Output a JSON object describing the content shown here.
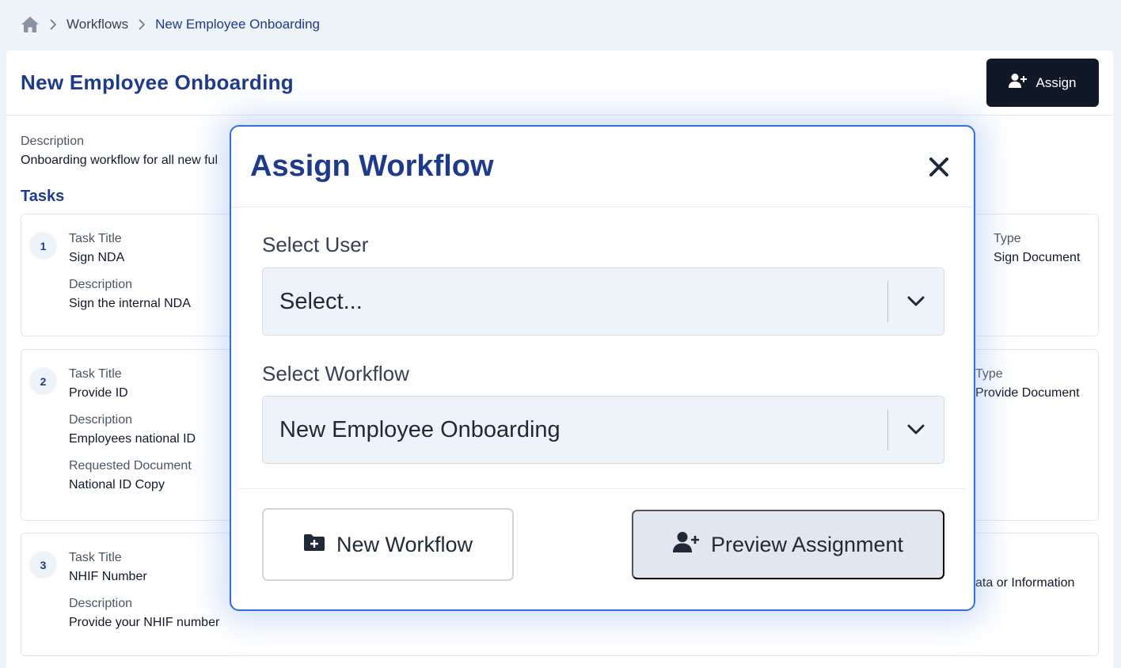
{
  "breadcrumb": {
    "home_icon": "home-icon",
    "items": [
      "Workflows",
      "New Employee Onboarding"
    ]
  },
  "page": {
    "title": "New Employee Onboarding",
    "assign_label": "Assign",
    "description_label": "Description",
    "description_value": "Onboarding workflow for all new ful",
    "tasks_title": "Tasks"
  },
  "tasks": [
    {
      "number": "1",
      "title_label": "Task Title",
      "title": "Sign NDA",
      "desc_label": "Description",
      "desc": "Sign the internal NDA",
      "type_label": "Type",
      "type": "Sign Document"
    },
    {
      "number": "2",
      "title_label": "Task Title",
      "title": "Provide ID",
      "desc_label": "Description",
      "desc": "Employees national ID",
      "doc_label": "Requested Document",
      "doc": "National ID Copy",
      "type_label": "Type",
      "type": "Provide Document"
    },
    {
      "number": "3",
      "title_label": "Task Title",
      "title": "NHIF Number",
      "desc_label": "Description",
      "desc": "Provide your NHIF number",
      "type": "ata or Information"
    }
  ],
  "modal": {
    "title": "Assign Workflow",
    "user_label": "Select User",
    "user_value": "Select...",
    "workflow_label": "Select Workflow",
    "workflow_value": "New Employee Onboarding",
    "new_workflow_label": "New Workflow",
    "preview_label": "Preview Assignment"
  },
  "colors": {
    "accent": "#1e3a8a",
    "modal_border": "#2f6fe0",
    "dark_button": "#111827",
    "background": "#eef2f9"
  }
}
